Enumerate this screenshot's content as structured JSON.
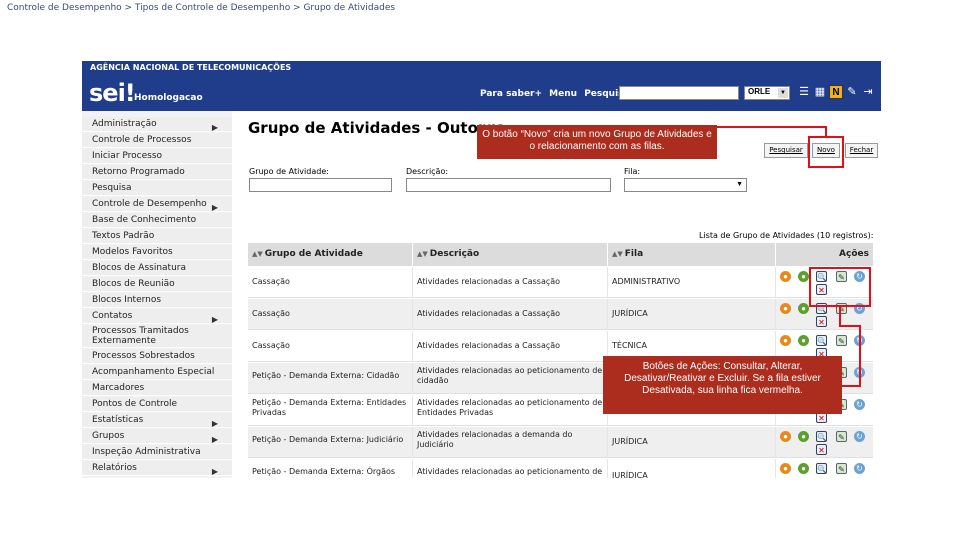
{
  "breadcrumb": "Controle de Desempenho > Tipos de Controle de Desempenho > Grupo de Atividades",
  "app": {
    "agency": "AGÊNCIA NACIONAL DE TELECOMUNICAÇÕES",
    "logo": "sei!",
    "environment": "Homologacao",
    "links": [
      "Para saber+",
      "Menu",
      "Pesquisa"
    ],
    "unit_value": "ORLE"
  },
  "colors": {
    "header": "#1f3d8a",
    "callout": "#ac2d1e",
    "highlight": "#e0101a"
  },
  "sidebar": {
    "items": [
      {
        "label": "Administração",
        "arrow": "▶"
      },
      {
        "label": "Controle de Processos",
        "arrow": ""
      },
      {
        "label": "Iniciar Processo",
        "arrow": ""
      },
      {
        "label": "Retorno Programado",
        "arrow": ""
      },
      {
        "label": "Pesquisa",
        "arrow": ""
      },
      {
        "label": "Controle de Desempenho",
        "arrow": "▶"
      },
      {
        "label": "Base de Conhecimento",
        "arrow": ""
      },
      {
        "label": "Textos Padrão",
        "arrow": ""
      },
      {
        "label": "Modelos Favoritos",
        "arrow": ""
      },
      {
        "label": "Blocos de Assinatura",
        "arrow": ""
      },
      {
        "label": "Blocos de Reunião",
        "arrow": ""
      },
      {
        "label": "Blocos Internos",
        "arrow": ""
      },
      {
        "label": "Contatos",
        "arrow": "▶"
      },
      {
        "label": "Processos Tramitados Externamente",
        "arrow": ""
      },
      {
        "label": "Processos Sobrestados",
        "arrow": ""
      },
      {
        "label": "Acompanhamento Especial",
        "arrow": ""
      },
      {
        "label": "Marcadores",
        "arrow": ""
      },
      {
        "label": "Pontos de Controle",
        "arrow": ""
      },
      {
        "label": "Estatísticas",
        "arrow": "▶"
      },
      {
        "label": "Grupos",
        "arrow": "▶"
      },
      {
        "label": "Inspeção Administrativa",
        "arrow": ""
      },
      {
        "label": "Relatórios",
        "arrow": "▶"
      }
    ]
  },
  "page": {
    "title": "Grupo de Atividades - Outorga",
    "buttons": {
      "search": "Pesquisar",
      "new": "Novo",
      "close": "Fechar"
    },
    "filters": {
      "group_label": "Grupo de Atividade:",
      "description_label": "Descrição:",
      "queue_label": "Fila:"
    },
    "table_caption": "Lista de Grupo de Atividades (10 registros):",
    "columns": [
      "Grupo de Atividade",
      "Descrição",
      "Fila",
      "Ações"
    ],
    "rows": [
      {
        "group": "Cassação",
        "desc": "Atividades relacionadas a Cassação",
        "queue": "ADMINISTRATIVO"
      },
      {
        "group": "Cassação",
        "desc": "Atividades relacionadas a Cassação",
        "queue": "JURÍDICA"
      },
      {
        "group": "Cassação",
        "desc": "Atividades relacionadas a Cassação",
        "queue": "TÉCNICA"
      },
      {
        "group": "Petição - Demanda Externa: Cidadão",
        "desc": "Atividades relacionadas ao peticionamento de cidadão",
        "queue": ""
      },
      {
        "group": "Petição - Demanda Externa: Entidades Privadas",
        "desc": "Atividades relacionadas ao peticionamento de Entidades Privadas",
        "queue": ""
      },
      {
        "group": "Petição - Demanda Externa: Judiciário",
        "desc": "Atividades relacionadas a demanda do Judiciário",
        "queue": "JURÍDICA"
      },
      {
        "group": "Petição - Demanda Externa: Órgãos",
        "desc": "Atividades relacionadas ao peticionamento de",
        "queue": "JURÍDICA"
      }
    ]
  },
  "annotations": {
    "new_button_note": "O botão “Novo” cria um novo Grupo de Atividades e o relacionamento com as filas.",
    "actions_note": "Botões de Ações: Consultar, Alterar, Desativar/Reativar e Excluir. Se a fila estiver Desativada, sua linha fica vermelha."
  }
}
